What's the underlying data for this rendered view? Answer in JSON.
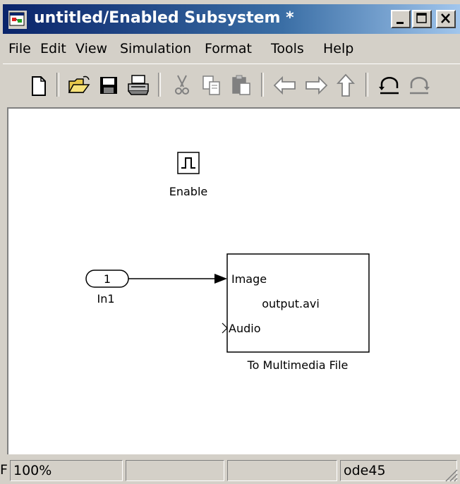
{
  "window": {
    "title": "untitled/Enabled Subsystem *"
  },
  "menu": {
    "items": [
      "File",
      "Edit",
      "View",
      "Simulation",
      "Format",
      "Tools",
      "Help"
    ]
  },
  "toolbar": {
    "buttons": [
      "new-icon",
      "open-icon",
      "save-icon",
      "print-icon",
      "cut-icon",
      "copy-icon",
      "paste-icon",
      "back-icon",
      "forward-icon",
      "up-icon",
      "undo-icon",
      "redo-icon"
    ]
  },
  "diagram": {
    "enable_block": {
      "label": "Enable"
    },
    "inport_block": {
      "number": "1",
      "label": "In1"
    },
    "multimedia_block": {
      "port_image": "Image",
      "port_audio": "Audio",
      "filename": "output.avi",
      "label": "To Multimedia File"
    }
  },
  "status": {
    "left_char": "F",
    "zoom": "100%",
    "cell2": "",
    "cell3": "",
    "solver": "ode45"
  },
  "colors": {
    "titlebar_start": "#0a246a",
    "titlebar_end": "#a6caf0",
    "chrome": "#d4d0c8",
    "canvas": "#ffffff"
  }
}
